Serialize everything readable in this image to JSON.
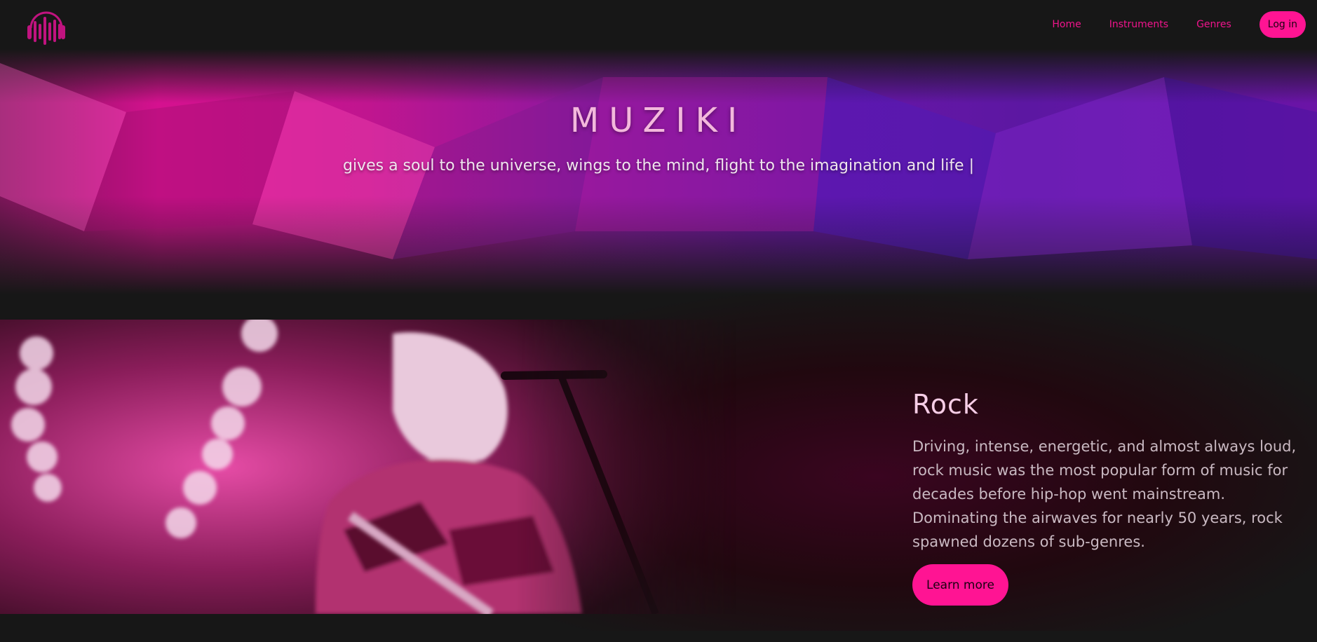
{
  "nav": {
    "logo": "headphones-logo",
    "links": [
      {
        "label": "Home"
      },
      {
        "label": "Instruments"
      },
      {
        "label": "Genres"
      }
    ],
    "login_label": "Log in"
  },
  "hero": {
    "title": "MUZIKI",
    "subtitle": "gives a soul to the universe, wings to the mind, flight to the imagination and life |"
  },
  "feature": {
    "genre": "Rock",
    "description": "Driving, intense, energetic, and almost always loud, rock music was the most popular form of music for decades before hip-hop went mainstream. Dominating the airwaves for nearly 50 years, rock spawned dozens of sub-genres.",
    "cta_label": "Learn more"
  },
  "colors": {
    "accent": "#ff1493",
    "background": "#171717"
  }
}
